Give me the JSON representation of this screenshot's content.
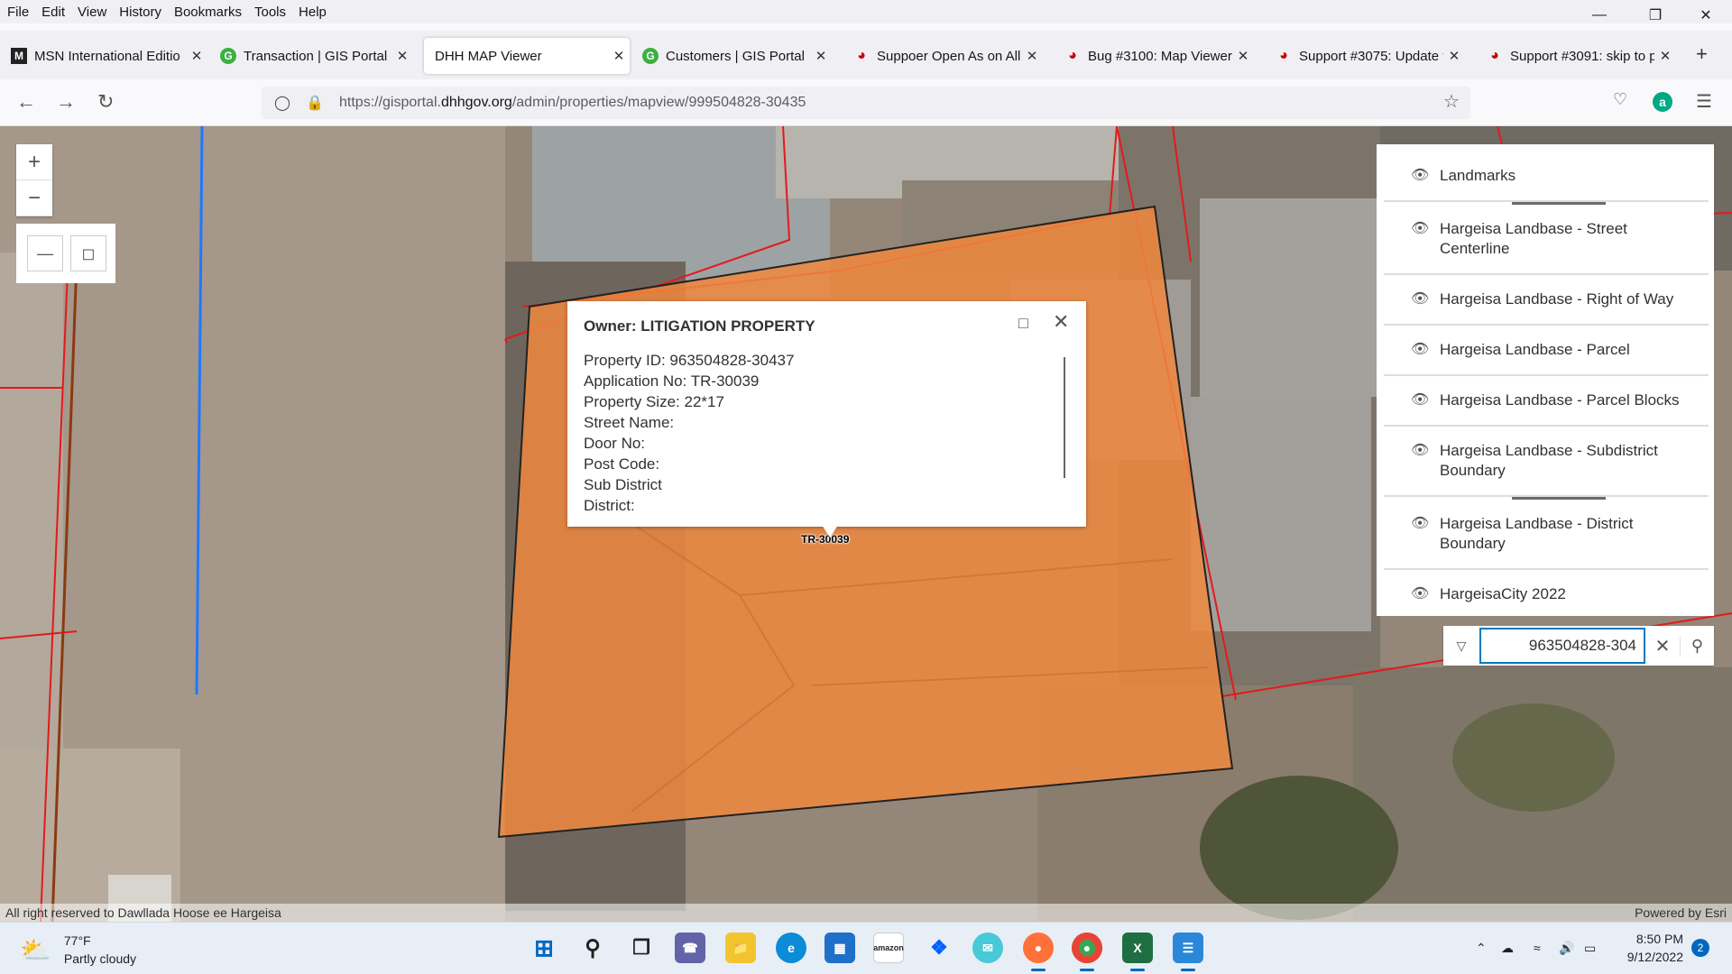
{
  "menu": [
    "File",
    "Edit",
    "View",
    "History",
    "Bookmarks",
    "Tools",
    "Help"
  ],
  "tabs": [
    {
      "title": "MSN International Editio",
      "icon": "msn-icon"
    },
    {
      "title": "Transaction | GIS Portal",
      "icon": "gis-portal-icon"
    },
    {
      "title": "DHH MAP Viewer",
      "icon": "none"
    },
    {
      "title": "Customers | GIS Portal",
      "icon": "gis-portal-icon"
    },
    {
      "title": "Suppoer Open As on All",
      "icon": "redmine-icon"
    },
    {
      "title": "Bug #3100: Map Viewer",
      "icon": "redmine-icon"
    },
    {
      "title": "Support #3075: Update t",
      "icon": "redmine-icon"
    },
    {
      "title": "Support #3091: skip to p",
      "icon": "redmine-icon"
    }
  ],
  "url": {
    "prefix": "https://gisportal.",
    "domain": "dhhgov.org",
    "path": "/admin/properties/mapview/999504828-30435"
  },
  "popup": {
    "title": "Owner: LITIGATION PROPERTY",
    "fields": [
      "Property ID: 963504828-30437",
      "Application No: TR-30039",
      "Property Size: 22*17",
      "Street Name:",
      "Door No:",
      "Post Code:",
      "Sub District",
      "District:"
    ]
  },
  "parcel_label": "TR-30039",
  "layers": [
    "Landmarks",
    "Hargeisa Landbase - Street Centerline",
    "Hargeisa Landbase - Right of Way",
    "Hargeisa Landbase - Parcel",
    "Hargeisa Landbase - Parcel Blocks",
    "Hargeisa Landbase - Subdistrict Boundary",
    "Hargeisa Landbase - District Boundary",
    "HargeisaCity 2022"
  ],
  "search": {
    "value": "963504828-304"
  },
  "attribution": {
    "left": "All right reserved to Dawllada Hoose ee Hargeisa",
    "right": "Powered by Esri"
  },
  "taskbar": {
    "temp": "77°F",
    "weather": "Partly cloudy",
    "time": "8:50 PM",
    "date": "9/12/2022",
    "notifications": "2"
  },
  "colors": {
    "parcel_fill": "#f0883e",
    "parcel_line": "#e31a1c",
    "street_line": "#1f78ff",
    "accent": "#0079c1"
  }
}
